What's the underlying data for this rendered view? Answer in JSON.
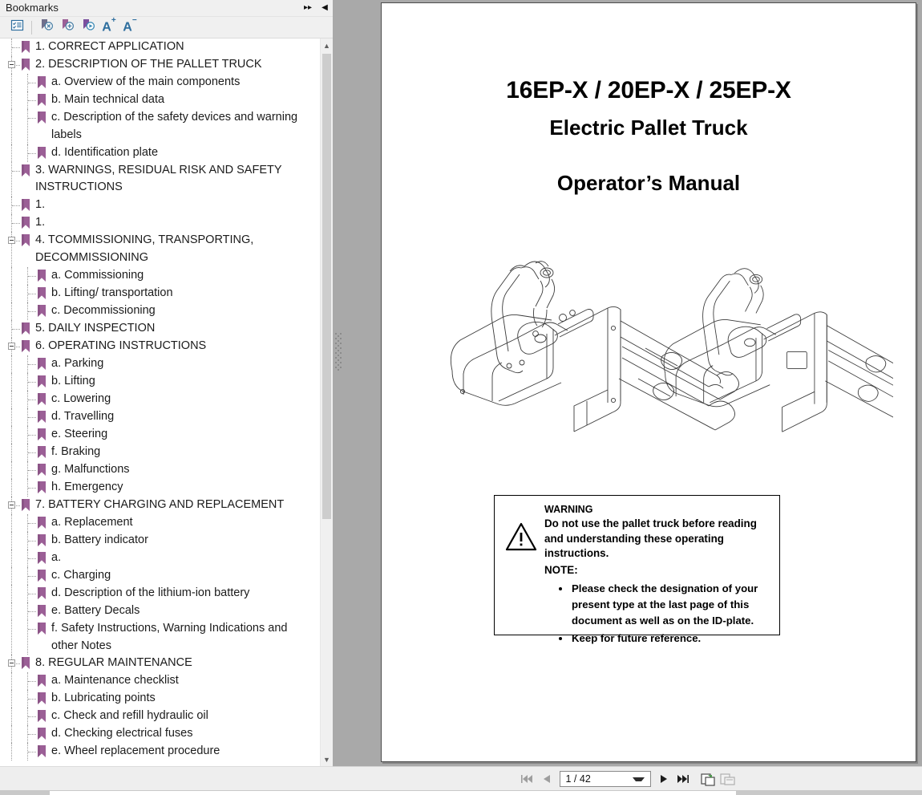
{
  "panel": {
    "title": "Bookmarks",
    "header_buttons": [
      {
        "name": "expand-panel",
        "glyph": "▸▸"
      },
      {
        "name": "collapse-panel",
        "glyph": "◀"
      }
    ],
    "toolbar": [
      {
        "name": "bookmark-options-button",
        "icon": "list-options-icon"
      },
      {
        "name": "delete-bookmark-button",
        "icon": "bookmark-delete-icon"
      },
      {
        "name": "add-bookmark-button",
        "icon": "bookmark-add-icon"
      },
      {
        "name": "goto-bookmark-button",
        "icon": "bookmark-goto-icon"
      },
      {
        "name": "increase-font-button",
        "icon": "font-increase-icon",
        "label": "A",
        "sup": "+"
      },
      {
        "name": "decrease-font-button",
        "icon": "font-decrease-icon",
        "label": "A",
        "sup": "−"
      }
    ]
  },
  "bookmarks": [
    {
      "label": "1. CORRECT APPLICATION",
      "level": 0,
      "expander": false,
      "lines": 1
    },
    {
      "label": "2.  DESCRIPTION OF THE PALLET TRUCK",
      "level": 0,
      "expander": true,
      "lines": 1
    },
    {
      "label": "a.  Overview of the main components",
      "level": 1,
      "expander": false,
      "lines": 1
    },
    {
      "label": "b.  Main technical data",
      "level": 1,
      "expander": false,
      "lines": 1
    },
    {
      "label": "c. Description of the safety devices and warning labels",
      "level": 1,
      "expander": false,
      "lines": 2
    },
    {
      "label": "d. Identification plate",
      "level": 1,
      "expander": false,
      "lines": 1
    },
    {
      "label": "3. WARNINGS, RESIDUAL RISK AND SAFETY INSTRUCTIONS",
      "level": 0,
      "expander": false,
      "lines": 2
    },
    {
      "label": "1.",
      "level": 0,
      "expander": false,
      "lines": 1
    },
    {
      "label": "1.",
      "level": 0,
      "expander": false,
      "lines": 1
    },
    {
      "label": "4. TCOMMISSIONING, TRANSPORTING, DECOMMISSIONING",
      "level": 0,
      "expander": true,
      "lines": 2
    },
    {
      "label": "a.  Commissioning",
      "level": 1,
      "expander": false,
      "lines": 1
    },
    {
      "label": "b.  Lifting/ transportation",
      "level": 1,
      "expander": false,
      "lines": 1
    },
    {
      "label": "c.  Decommissioning",
      "level": 1,
      "expander": false,
      "lines": 1
    },
    {
      "label": "5. DAILY INSPECTION",
      "level": 0,
      "expander": false,
      "lines": 1
    },
    {
      "label": "6. OPERATING INSTRUCTIONS",
      "level": 0,
      "expander": true,
      "lines": 1
    },
    {
      "label": "a.  Parking",
      "level": 1,
      "expander": false,
      "lines": 1
    },
    {
      "label": "b.  Lifting",
      "level": 1,
      "expander": false,
      "lines": 1
    },
    {
      "label": "c.  Lowering",
      "level": 1,
      "expander": false,
      "lines": 1
    },
    {
      "label": "d.  Travelling",
      "level": 1,
      "expander": false,
      "lines": 1
    },
    {
      "label": "e.  Steering",
      "level": 1,
      "expander": false,
      "lines": 1
    },
    {
      "label": "f.  Braking",
      "level": 1,
      "expander": false,
      "lines": 1
    },
    {
      "label": "g.  Malfunctions",
      "level": 1,
      "expander": false,
      "lines": 1
    },
    {
      "label": "h.  Emergency",
      "level": 1,
      "expander": false,
      "lines": 1
    },
    {
      "label": "7. BATTERY CHARGING AND REPLACEMENT",
      "level": 0,
      "expander": true,
      "lines": 1
    },
    {
      "label": "a.  Replacement",
      "level": 1,
      "expander": false,
      "lines": 1
    },
    {
      "label": "b.  Battery indicator",
      "level": 1,
      "expander": false,
      "lines": 1
    },
    {
      "label": "a.",
      "level": 1,
      "expander": false,
      "lines": 1
    },
    {
      "label": "c.  Charging",
      "level": 1,
      "expander": false,
      "lines": 1
    },
    {
      "label": "d.  Description of the lithium-ion battery",
      "level": 1,
      "expander": false,
      "lines": 1
    },
    {
      "label": "e. Battery Decals",
      "level": 1,
      "expander": false,
      "lines": 1
    },
    {
      "label": "f. Safety Instructions, Warning Indications and other Notes",
      "level": 1,
      "expander": false,
      "lines": 2
    },
    {
      "label": "8. REGULAR MAINTENANCE",
      "level": 0,
      "expander": true,
      "lines": 1
    },
    {
      "label": "a.  Maintenance checklist",
      "level": 1,
      "expander": false,
      "lines": 1
    },
    {
      "label": "b.  Lubricating points",
      "level": 1,
      "expander": false,
      "lines": 1
    },
    {
      "label": "c.  Check and refill hydraulic oil",
      "level": 1,
      "expander": false,
      "lines": 1
    },
    {
      "label": "d.  Checking electrical fuses",
      "level": 1,
      "expander": false,
      "lines": 1
    },
    {
      "label": "e. Wheel replacement procedure",
      "level": 1,
      "expander": false,
      "lines": 1
    }
  ],
  "document": {
    "title_models": "16EP-X / 20EP-X / 25EP-X",
    "title_product": "Electric Pallet Truck",
    "title_doctype": "Operator’s Manual",
    "warning": {
      "heading": "WARNING",
      "text": "Do not use the pallet truck before reading and understanding these operating instructions.",
      "note_label": "NOTE:",
      "notes": [
        "Please check the designation of your present type at the last page of this document as well as on the ID-plate.",
        "Keep for future reference."
      ]
    }
  },
  "navigation": {
    "first_page_label": "◀❘",
    "prev_page_label": "◀",
    "next_page_label": "▶",
    "last_page_label": "❘▶",
    "page_value": "1 / 42",
    "view_single_icon": "single-page-view-icon",
    "view_facing_icon": "facing-page-view-icon"
  },
  "colors": {
    "bookmark_icon": "#9b5f96",
    "accent_blue": "#2e6e9e",
    "panel_bg": "#f0f0f0",
    "viewer_bg": "#a9a9a9"
  }
}
